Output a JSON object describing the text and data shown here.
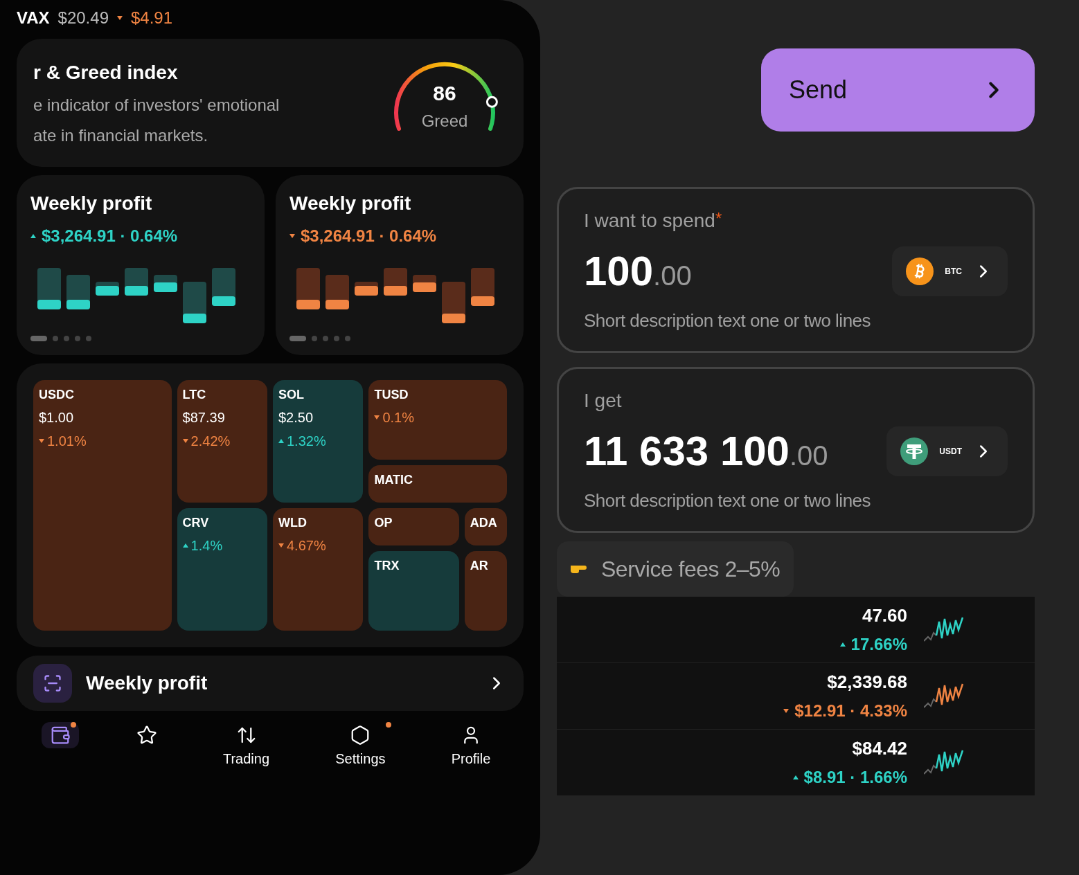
{
  "phone": {
    "ticker": {
      "symbol": "VAX",
      "price": "$20.49",
      "change": "$4.91",
      "rising": false
    },
    "fear_greed": {
      "title": "r & Greed index",
      "description_lines": [
        "e indicator of investors' emotional",
        "ate in financial markets."
      ],
      "value": "86",
      "label": "Greed",
      "level": 0.86
    },
    "profit_cards": [
      {
        "title": "Weekly profit",
        "change": "$3,264.91 · 0.64%",
        "rising": true,
        "pages": [
          true,
          false,
          false,
          false,
          false
        ]
      },
      {
        "title": "Weekly profit",
        "change": "$3,264.91 · 0.64%",
        "rising": false,
        "pages": [
          true,
          false,
          false,
          false,
          false
        ]
      }
    ],
    "treemap": [
      {
        "name": "USDC",
        "price": "$1.00",
        "change": "1.01%",
        "rising": false
      },
      {
        "name": "LTC",
        "price": "$87.39",
        "change": "2.42%",
        "rising": false
      },
      {
        "name": "SOL",
        "price": "$2.50",
        "change": "1.32%",
        "rising": true
      },
      {
        "name": "TUSD",
        "change": "0.1%",
        "rising": false
      },
      {
        "name": "MATIC",
        "rising": false
      },
      {
        "name": "CRV",
        "change": "1.4%",
        "rising": true
      },
      {
        "name": "WLD",
        "change": "4.67%",
        "rising": false
      },
      {
        "name": "OP",
        "rising": false
      },
      {
        "name": "ADA",
        "rising": false
      },
      {
        "name": "TRX",
        "rising": true
      },
      {
        "name": "AR",
        "rising": false
      }
    ],
    "promo": {
      "title": "Weekly profit"
    },
    "nav": [
      {
        "kind": "wallet",
        "selected": true,
        "badge": true
      },
      {
        "kind": "star",
        "selected": false,
        "badge": false
      },
      {
        "kind": "trading",
        "label": "Trading",
        "selected": false,
        "badge": false
      },
      {
        "kind": "settings",
        "label": "Settings",
        "selected": false,
        "badge": true
      },
      {
        "kind": "profile",
        "label": "Profile",
        "selected": false,
        "badge": false
      }
    ]
  },
  "send_button": {
    "label": "Send"
  },
  "exchange": [
    {
      "label": "I want to spend",
      "required_mark": "*",
      "whole": "100",
      "fraction": ".00",
      "currency": "BTC",
      "kind": "bitcoin",
      "hint": "Short description text one or two lines"
    },
    {
      "label": "I get",
      "whole": "11 633 100",
      "fraction": ".00",
      "currency": "USDT",
      "kind": "tether",
      "hint": "Short description text one or two lines"
    }
  ],
  "fee_note": {
    "text": "Service fees 2–5%"
  },
  "assets": [
    {
      "price": "47.60",
      "change": "17.66%",
      "rising": true
    },
    {
      "price": "$2,339.68",
      "change": "$12.91 · 4.33%",
      "rising": false
    },
    {
      "price": "$84.42",
      "change": "$8.91 · 1.66%",
      "rising": true
    }
  ]
}
